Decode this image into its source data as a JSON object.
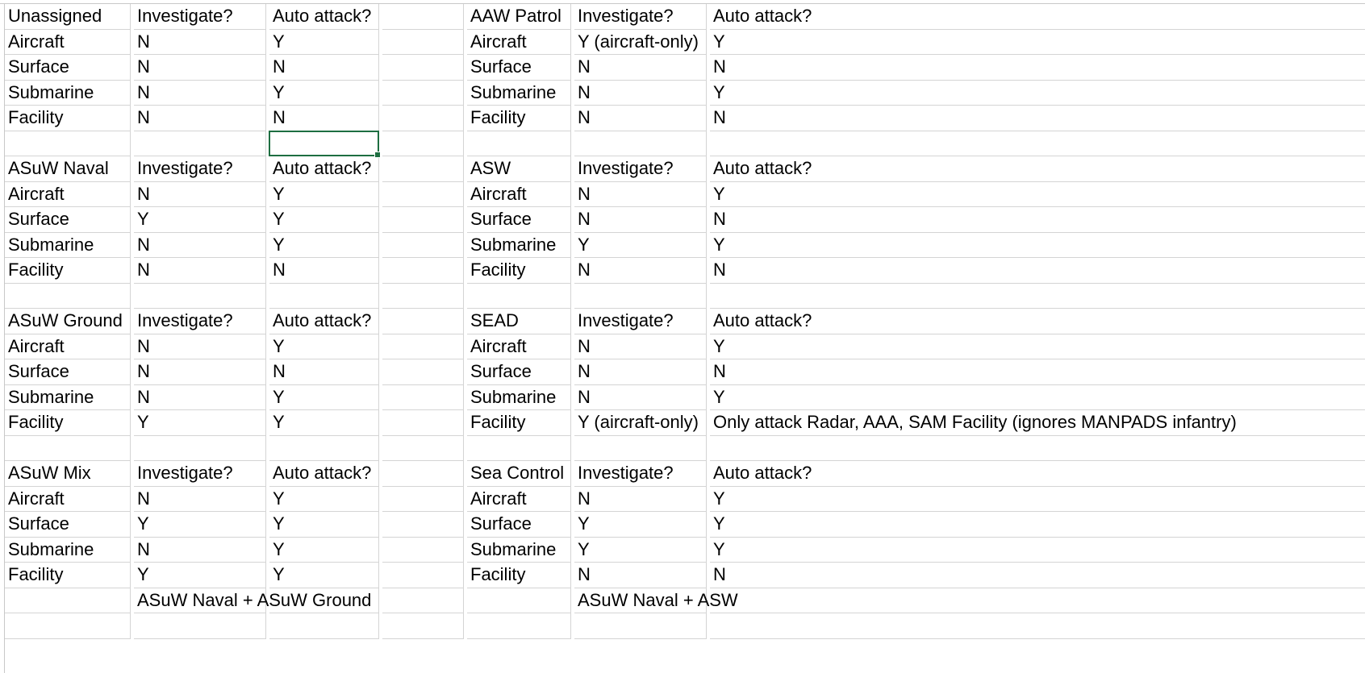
{
  "colors": {
    "gridline": "#d4d4d4",
    "selection": "#1e6e41",
    "text": "#000000",
    "background": "#ffffff"
  },
  "selected_cell": {
    "row": 5,
    "col": 2
  },
  "rows": [
    [
      "Unassigned",
      "Investigate?",
      "Auto attack?",
      "",
      "AAW Patrol",
      "Investigate?",
      "Auto attack?"
    ],
    [
      "Aircraft",
      "N",
      "Y",
      "",
      "Aircraft",
      "Y (aircraft-only)",
      "Y"
    ],
    [
      "Surface",
      "N",
      "N",
      "",
      "Surface",
      "N",
      "N"
    ],
    [
      "Submarine",
      "N",
      "Y",
      "",
      "Submarine",
      "N",
      "Y"
    ],
    [
      "Facility",
      "N",
      "N",
      "",
      "Facility",
      "N",
      "N"
    ],
    [
      "",
      "",
      "",
      "",
      "",
      "",
      ""
    ],
    [
      "ASuW Naval",
      "Investigate?",
      "Auto attack?",
      "",
      "ASW",
      "Investigate?",
      "Auto attack?"
    ],
    [
      "Aircraft",
      "N",
      "Y",
      "",
      "Aircraft",
      "N",
      "Y"
    ],
    [
      "Surface",
      "Y",
      "Y",
      "",
      "Surface",
      "N",
      "N"
    ],
    [
      "Submarine",
      "N",
      "Y",
      "",
      "Submarine",
      "Y",
      "Y"
    ],
    [
      "Facility",
      "N",
      "N",
      "",
      "Facility",
      "N",
      "N"
    ],
    [
      "",
      "",
      "",
      "",
      "",
      "",
      ""
    ],
    [
      "ASuW Ground",
      "Investigate?",
      "Auto attack?",
      "",
      "SEAD",
      "Investigate?",
      "Auto attack?"
    ],
    [
      "Aircraft",
      "N",
      "Y",
      "",
      "Aircraft",
      "N",
      "Y"
    ],
    [
      "Surface",
      "N",
      "N",
      "",
      "Surface",
      "N",
      "N"
    ],
    [
      "Submarine",
      "N",
      "Y",
      "",
      "Submarine",
      "N",
      "Y"
    ],
    [
      "Facility",
      "Y",
      "Y",
      "",
      "Facility",
      "Y (aircraft-only)",
      "Only attack Radar, AAA, SAM Facility  (ignores MANPADS infantry)"
    ],
    [
      "",
      "",
      "",
      "",
      "",
      "",
      ""
    ],
    [
      "ASuW Mix",
      "Investigate?",
      "Auto attack?",
      "",
      "Sea Control",
      "Investigate?",
      "Auto attack?"
    ],
    [
      "Aircraft",
      "N",
      "Y",
      "",
      "Aircraft",
      "N",
      "Y"
    ],
    [
      "Surface",
      "Y",
      "Y",
      "",
      "Surface",
      "Y",
      "Y"
    ],
    [
      "Submarine",
      "N",
      "Y",
      "",
      "Submarine",
      "Y",
      "Y"
    ],
    [
      "Facility",
      "Y",
      "Y",
      "",
      "Facility",
      "N",
      "N"
    ],
    [
      "",
      "ASuW Naval + ASuW Ground",
      "",
      "",
      "",
      "ASuW Naval + ASW",
      ""
    ],
    [
      "",
      "",
      "",
      "",
      "",
      "",
      ""
    ]
  ]
}
